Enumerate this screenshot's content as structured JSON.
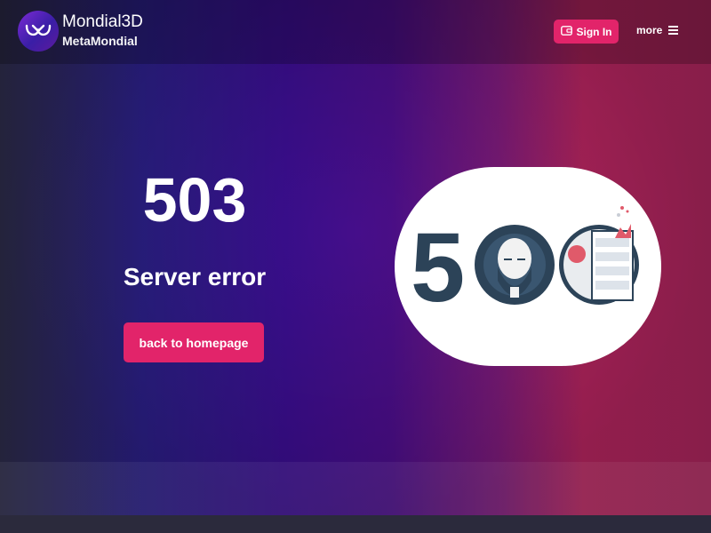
{
  "header": {
    "brand_title": "Mondial3D",
    "brand_subtitle": "MetaMondial",
    "signin_label": "Sign In",
    "more_label": "more"
  },
  "error": {
    "code": "503",
    "message": "Server error",
    "button_label": "back to homepage"
  },
  "colors": {
    "accent": "#e2246a",
    "illustration_dark": "#2c4358"
  },
  "icons": {
    "logo": "mondial-logo-icon",
    "signin": "wallet-icon",
    "more": "hamburger-icon"
  }
}
